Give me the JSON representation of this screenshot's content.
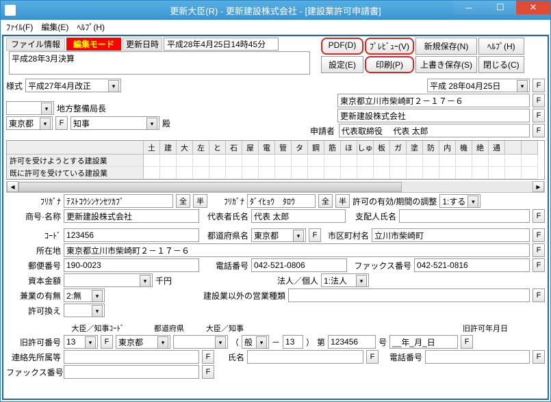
{
  "titlebar": {
    "text": "更新大臣(R) - 更新建設株式会社 - [建設業許可申請書]"
  },
  "menu": {
    "file": "ﾌｧｲﾙ(F)",
    "edit": "編集(E)",
    "help": "ﾍﾙﾌﾟ(H)"
  },
  "header": {
    "file_info_label": "ファイル情報",
    "edit_mode": "編集モード",
    "update_time_label": "更新日時",
    "update_time_value": "平成28年4月25日14時45分",
    "file_text": "平成28年3月決算"
  },
  "toolbar": {
    "pdf": "PDF(D)",
    "preview": "ﾌﾟﾚﾋﾞｭｰ(V)",
    "newsave": "新規保存(N)",
    "help": "ﾍﾙﾌﾟ(H)",
    "settings": "設定(E)",
    "print": "印刷(P)",
    "overwrite": "上書き保存(S)",
    "close": "閉じる(C)"
  },
  "fmt": {
    "label": "様式",
    "value": "平成27年4月改正",
    "date": "平成 28年04月25日"
  },
  "addr": {
    "line1": "東京都立川市柴崎町２－１７－６",
    "company": "更新建設株式会社",
    "applicant_label": "申請者",
    "rep": "代表取締役　 代表 太郎",
    "bureau_label": "地方整備局長",
    "pref": "東京都",
    "gov": "知事",
    "dono": "殿"
  },
  "grid": {
    "cols": [
      "土",
      "建",
      "大",
      "左",
      "と",
      "石",
      "屋",
      "電",
      "管",
      "タ",
      "鋼",
      "筋",
      "ほ",
      "しゅ",
      "板",
      "ガ",
      "塗",
      "防",
      "内",
      "機",
      "絶",
      "通"
    ],
    "row1": "許可を受けようとする建設業",
    "row2": "既に許可を受けている建設業"
  },
  "fields": {
    "furigana_label": "ﾌﾘｶﾞﾅ",
    "furigana": "ﾃｽﾄｺｳｼﾝｹﾝｾﾂｶﾌﾞ",
    "zen": "全",
    "han": "半",
    "rep_furigana_label": "ﾌﾘｶﾞﾅ",
    "rep_furigana": "ﾀﾞｲﾋｮｳ　ﾀﾛｳ",
    "valid_label": "許可の有効/期間の調整",
    "valid_value": "1:する",
    "name_label": "商号·名称",
    "name": "更新建設株式会社",
    "rep_name_label": "代表者氏名",
    "rep_name": "代表 太郎",
    "manager_label": "支配人氏名",
    "manager": "",
    "code_label": "ｺｰﾄﾞ",
    "code": "123456",
    "pref_label": "都道府県名",
    "pref": "東京都",
    "city_label": "市区町村名",
    "city": "立川市柴崎町",
    "addr_label": "所在地",
    "addr": "東京都立川市柴崎町２－１７－６",
    "zip_label": "郵便番号",
    "zip": "190-0023",
    "tel_label": "電話番号",
    "tel": "042-521-0806",
    "fax_label": "ファックス番号",
    "fax": "042-521-0816",
    "capital_label": "資本金額",
    "capital": "",
    "capital_unit": "千円",
    "corp_label": "法人／個人",
    "corp": "1:法人",
    "sideline_label": "兼業の有無",
    "sideline": "2:無",
    "other_biz_label": "建設業以外の営業種類",
    "other_biz": "",
    "exchange_label": "許可換え",
    "minister_code_label": "大臣／知事ｺｰﾄﾞ",
    "minister_pref_label": "都道府県",
    "minister_label": "大臣／知事",
    "old_permit_label": "旧許可番号",
    "old_permit_code": "13",
    "old_permit_pref": "東京都",
    "kanji_open": "（",
    "general": "般",
    "dash": "－",
    "num": "13",
    "close": "）",
    "dai": "第",
    "permit_num": "123456",
    "gou": "号",
    "old_permit_date_label": "旧許可年月日",
    "old_permit_date": "__年_月_日",
    "contact_label": "連絡先所属等",
    "contact": "",
    "name2_label": "氏名",
    "name2": "",
    "tel2_label": "電話番号",
    "tel2": "",
    "fax2_label": "ファックス番号",
    "fax2": ""
  },
  "f": "F"
}
